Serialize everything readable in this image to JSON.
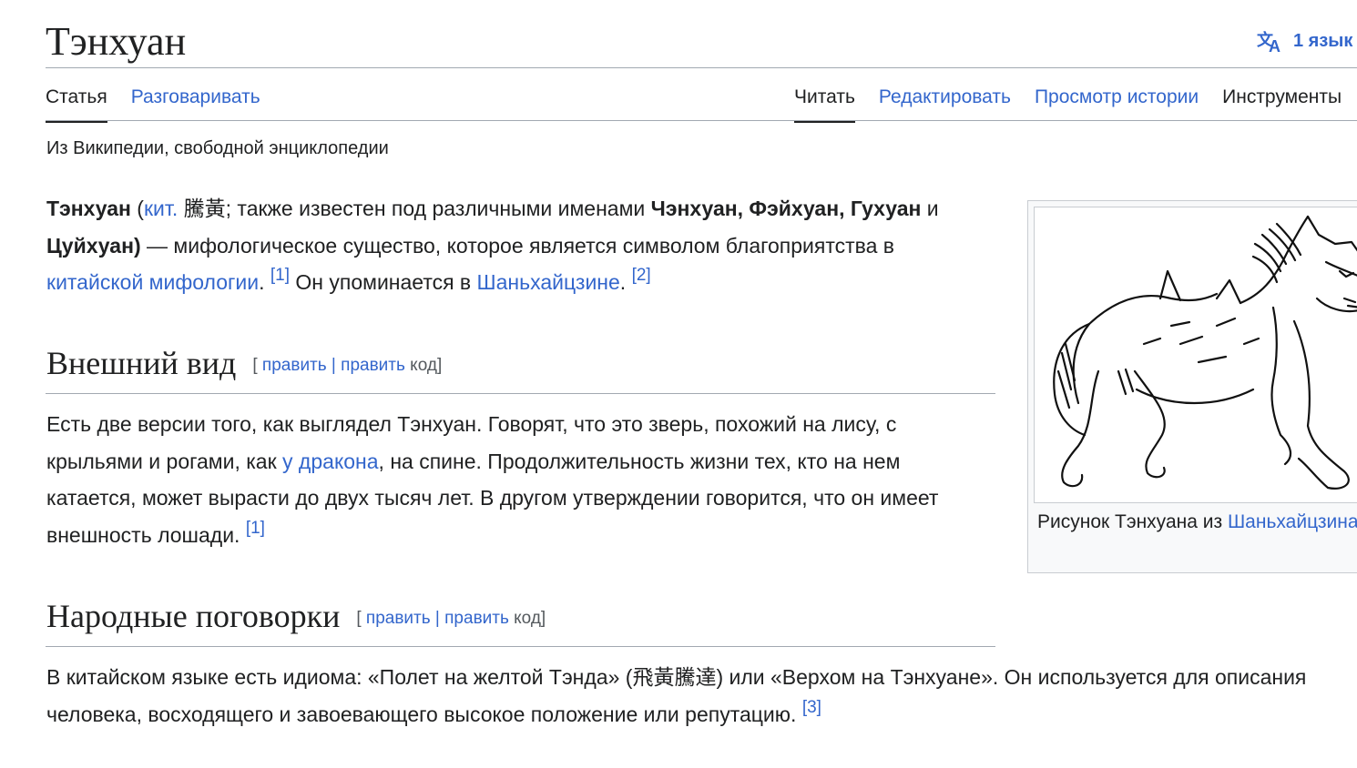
{
  "page": {
    "title": "Тэнхуан",
    "languages_label": "1 язык",
    "tagline": "Из Википедии, свободной энциклопедии"
  },
  "tabs": {
    "article": "Статья",
    "talk": "Разговаривать",
    "read": "Читать",
    "edit": "Редактировать",
    "history": "Просмотр истории",
    "tools": "Инструменты"
  },
  "intro": {
    "name": "Тэнхуан",
    "open_paren": " (",
    "lang_link": "кит.",
    "chinese": " 騰黃",
    "text1": "; также известен под различными именами ",
    "alt_names_1": "Чэнхуан, Фэйхуан, Гухуан",
    "and": " и ",
    "alt_names_2": "Цуйхуан)",
    "text2": " — мифологическое существо, которое является символом благоприятства в ",
    "myth_link": "китайской мифологии",
    "text3": ".",
    "ref1": "[1]",
    "text4": " Он упоминается в ",
    "shan_link": "Шаньхайцзине",
    "text5": ".",
    "ref2": "[2]"
  },
  "section1": {
    "heading": "Внешний вид",
    "edit_open": "[",
    "edit1": "править",
    "sep": " | ",
    "edit2": "править",
    "code": " код",
    "edit_close": "]",
    "text1": "Есть две версии того, как выглядел Тэнхуан. Говорят, что это зверь, похожий на лису, с крыльями и рогами, как ",
    "dragon_link": "у дракона",
    "text2": ", на спине. Продолжительность жизни тех, кто на нем катается, может вырасти до двух тысяч лет. В другом утверждении говорится, что он имеет внешность лошади.",
    "ref": "[1]"
  },
  "section2": {
    "heading": "Народные поговорки",
    "edit_open": "[",
    "edit1": "править",
    "sep": " | ",
    "edit2": "править",
    "code": " код",
    "edit_close": "]",
    "text1": "В китайском языке есть идиома: «Полет на желтой Тэнда» (飛黃騰達) или «Верхом на Тэнхуане». Он используется для описания человека, восходящего и завоевающего высокое положение или репутацию.",
    "ref": "[3]"
  },
  "infobox": {
    "caption_text": "Рисунок Тэнхуана из ",
    "caption_link": "Шаньхайцзина"
  },
  "colors": {
    "link": "#3366cc",
    "text": "#202122",
    "rule": "#a2a9b1"
  }
}
